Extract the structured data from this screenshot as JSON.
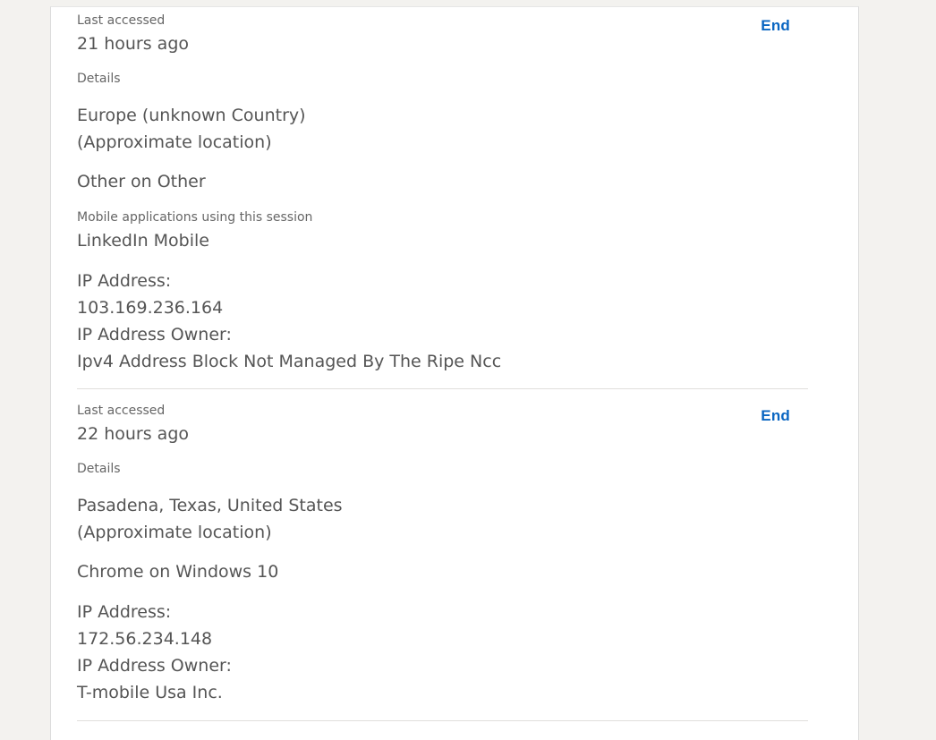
{
  "sessions": [
    {
      "last_accessed_label": "Last accessed",
      "last_accessed_value": "21 hours ago",
      "end_label": "End",
      "details_label": "Details",
      "location": "Europe (unknown Country)",
      "location_note": "(Approximate location)",
      "device": "Other on Other",
      "mobile_apps_label": "Mobile applications using this session",
      "mobile_apps_value": "LinkedIn Mobile",
      "ip_label": "IP Address:",
      "ip_value": "103.169.236.164",
      "ip_owner_label": "IP Address Owner:",
      "ip_owner_value": "Ipv4 Address Block Not Managed By The Ripe Ncc"
    },
    {
      "last_accessed_label": "Last accessed",
      "last_accessed_value": "22 hours ago",
      "end_label": "End",
      "details_label": "Details",
      "location": "Pasadena, Texas, United States",
      "location_note": "(Approximate location)",
      "device": "Chrome on Windows 10",
      "ip_label": "IP Address:",
      "ip_value": "172.56.234.148",
      "ip_owner_label": "IP Address Owner:",
      "ip_owner_value": "T-mobile Usa Inc."
    }
  ]
}
